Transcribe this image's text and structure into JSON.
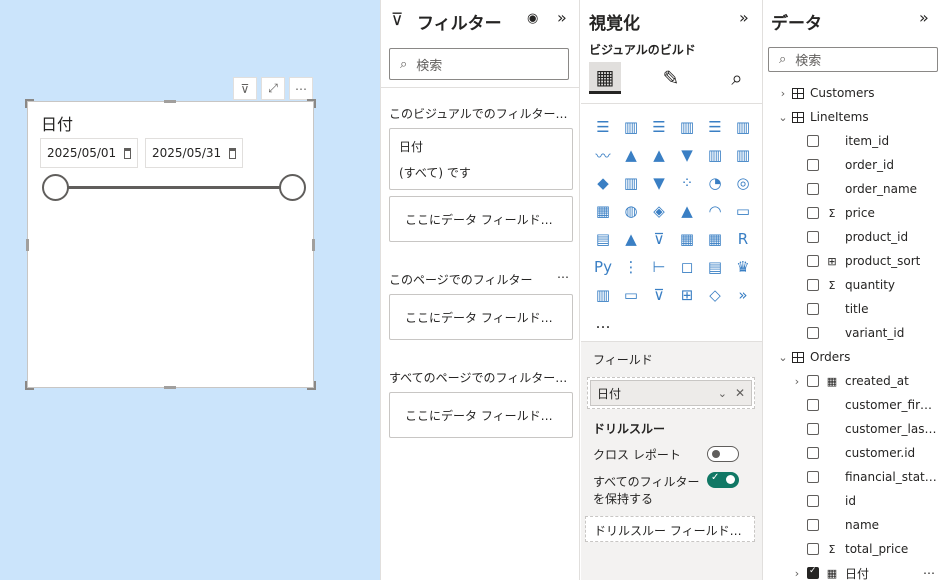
{
  "slicer": {
    "title": "日付",
    "start_date": "2025/05/01",
    "end_date": "2025/05/31"
  },
  "filters": {
    "title": "フィルター",
    "search_placeholder": "検索",
    "visual_section": "このビジュアルでのフィルター…",
    "visual_filter_field": "日付",
    "visual_filter_value": "(すべて) です",
    "drop_hint": "ここにデータ フィールド…",
    "page_section": "このページでのフィルター",
    "all_pages_section": "すべてのページでのフィルター…"
  },
  "visualizations": {
    "title": "視覚化",
    "build_label": "ビジュアルのビルド",
    "fields_label": "フィールド",
    "field_value": "日付",
    "drillthrough_label": "ドリルスルー",
    "cross_report_label": "クロス レポート",
    "cross_report_on": false,
    "keep_filters_label_1": "すべてのフィルター",
    "keep_filters_label_2": "を保持する",
    "keep_filters_on": true,
    "drill_well": "ドリルスルー フィールド…",
    "more": "…"
  },
  "data": {
    "title": "データ",
    "search_placeholder": "検索",
    "tables": [
      {
        "name": "Customers",
        "expanded": false,
        "fields": []
      },
      {
        "name": "LineItems",
        "expanded": true,
        "fields": [
          {
            "name": "item_id",
            "icon": ""
          },
          {
            "name": "order_id",
            "icon": ""
          },
          {
            "name": "order_name",
            "icon": ""
          },
          {
            "name": "price",
            "icon": "Σ"
          },
          {
            "name": "product_id",
            "icon": ""
          },
          {
            "name": "product_sort",
            "icon": "⊞"
          },
          {
            "name": "quantity",
            "icon": "Σ"
          },
          {
            "name": "title",
            "icon": ""
          },
          {
            "name": "variant_id",
            "icon": ""
          }
        ]
      },
      {
        "name": "Orders",
        "expanded": true,
        "fields": [
          {
            "name": "created_at",
            "icon": "▦",
            "expandable": true
          },
          {
            "name": "customer_first_…",
            "icon": ""
          },
          {
            "name": "customer_last_…",
            "icon": ""
          },
          {
            "name": "customer.id",
            "icon": ""
          },
          {
            "name": "financial_status",
            "icon": ""
          },
          {
            "name": "id",
            "icon": ""
          },
          {
            "name": "name",
            "icon": ""
          },
          {
            "name": "total_price",
            "icon": "Σ"
          },
          {
            "name": "日付",
            "icon": "▦",
            "expandable": true,
            "checked": true,
            "more": "⋯"
          }
        ]
      }
    ]
  },
  "colors": {
    "canvas": "#cbe4fb",
    "accent": "#117865"
  }
}
